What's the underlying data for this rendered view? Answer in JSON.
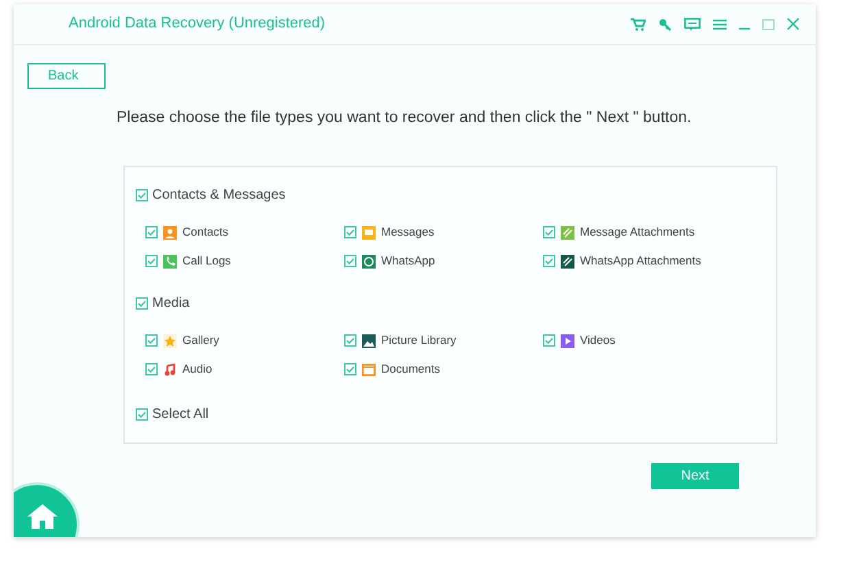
{
  "window": {
    "title": "Android Data Recovery (Unregistered)"
  },
  "back_button": "Back",
  "instruction": "Please choose the file types you want to recover and then click the \" Next \" button.",
  "sections": [
    {
      "label": "Contacts & Messages",
      "checked": true,
      "items": [
        {
          "label": "Contacts",
          "checked": true,
          "kind": "contacts"
        },
        {
          "label": "Messages",
          "checked": true,
          "kind": "messages"
        },
        {
          "label": "Message Attachments",
          "checked": true,
          "kind": "attachment"
        },
        {
          "label": "Call Logs",
          "checked": true,
          "kind": "calls"
        },
        {
          "label": "WhatsApp",
          "checked": true,
          "kind": "whatsapp"
        },
        {
          "label": "WhatsApp Attachments",
          "checked": true,
          "kind": "waattachment"
        }
      ]
    },
    {
      "label": "Media",
      "checked": true,
      "items": [
        {
          "label": "Gallery",
          "checked": true,
          "kind": "gallery"
        },
        {
          "label": "Picture Library",
          "checked": true,
          "kind": "picture"
        },
        {
          "label": "Videos",
          "checked": true,
          "kind": "video"
        },
        {
          "label": "Audio",
          "checked": true,
          "kind": "audio"
        },
        {
          "label": "Documents",
          "checked": true,
          "kind": "documents"
        }
      ]
    }
  ],
  "select_all": {
    "label": "Select All",
    "checked": true
  },
  "next_button": "Next"
}
